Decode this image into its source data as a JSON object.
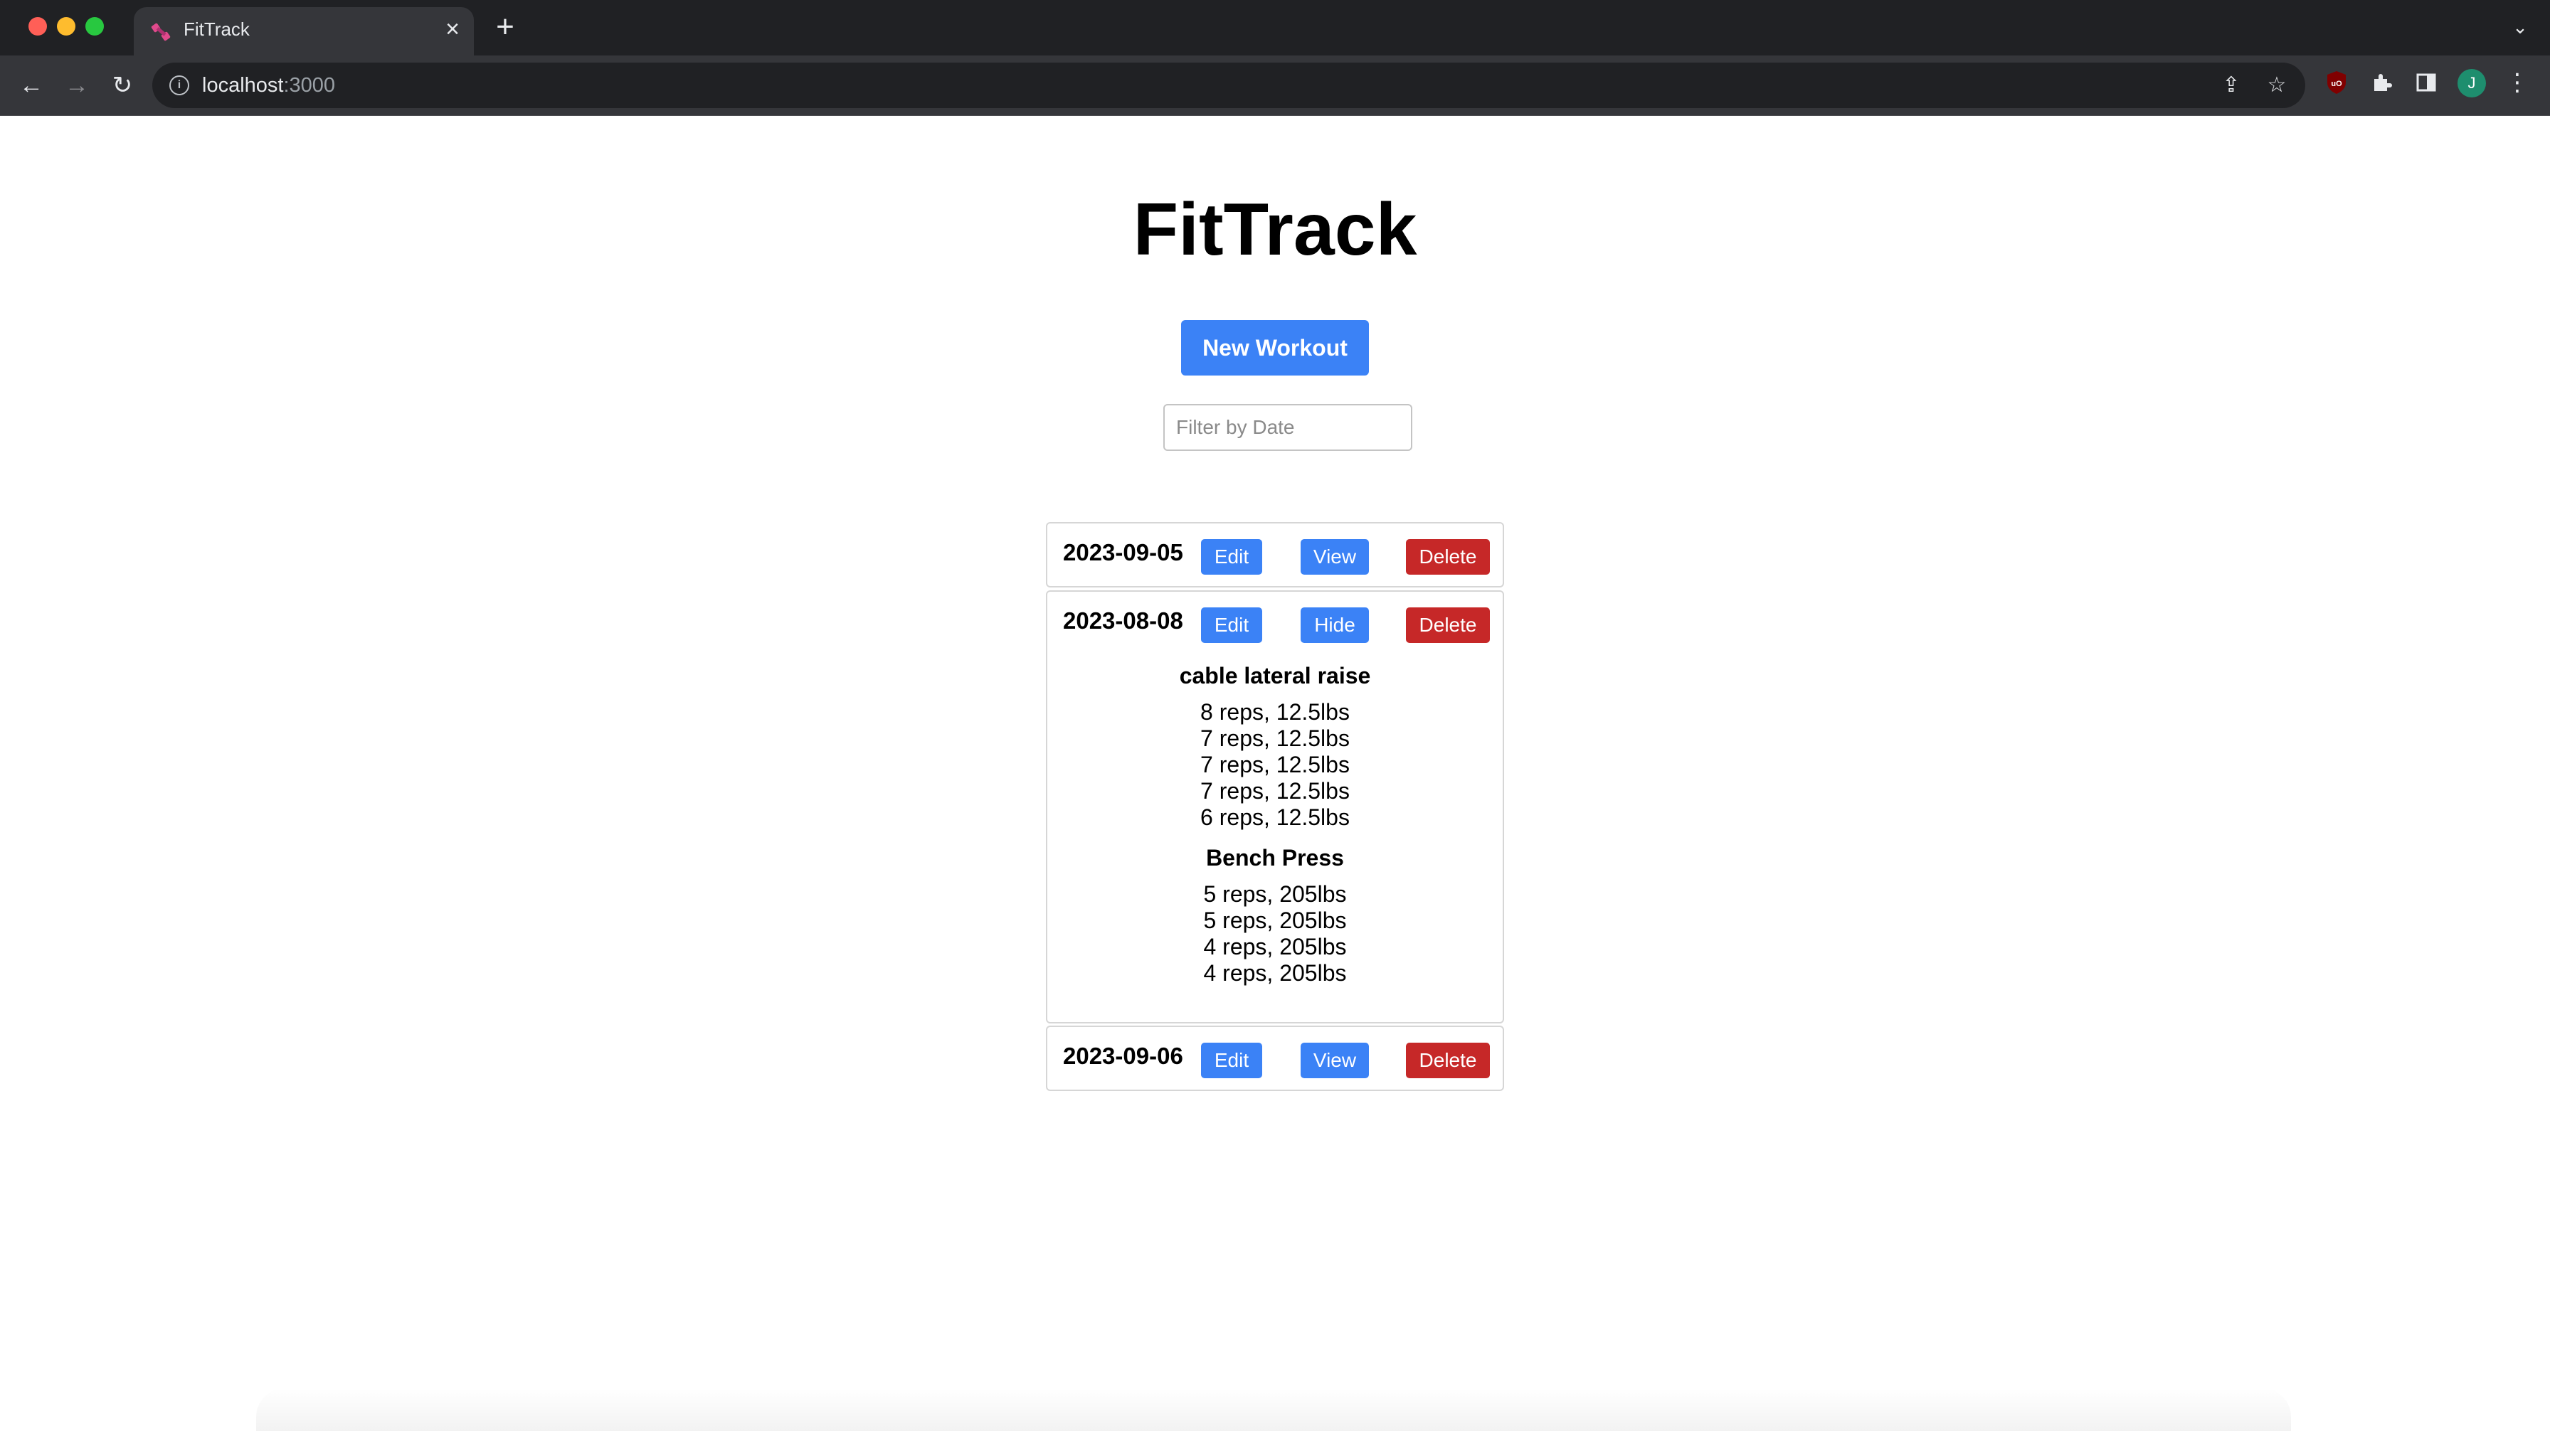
{
  "browser": {
    "tab_title": "FitTrack",
    "url_host": "localhost",
    "url_port": ":3000",
    "avatar_letter": "J"
  },
  "app": {
    "title": "FitTrack",
    "new_workout_label": "New Workout",
    "filter_placeholder": "Filter by Date",
    "filter_value": ""
  },
  "workouts": [
    {
      "date": "2023-09-05",
      "edit_label": "Edit",
      "toggle_label": "View",
      "delete_label": "Delete",
      "expanded": false
    },
    {
      "date": "2023-08-08",
      "edit_label": "Edit",
      "toggle_label": "Hide",
      "delete_label": "Delete",
      "expanded": true,
      "exercises": [
        {
          "name": "cable lateral raise",
          "sets": [
            "8 reps, 12.5lbs",
            "7 reps, 12.5lbs",
            "7 reps, 12.5lbs",
            "7 reps, 12.5lbs",
            "6 reps, 12.5lbs"
          ]
        },
        {
          "name": "Bench Press",
          "sets": [
            "5 reps, 205lbs",
            "5 reps, 205lbs",
            "4 reps, 205lbs",
            "4 reps, 205lbs"
          ]
        }
      ]
    },
    {
      "date": "2023-09-06",
      "edit_label": "Edit",
      "toggle_label": "View",
      "delete_label": "Delete",
      "expanded": false
    }
  ],
  "colors": {
    "primary": "#3b82f6",
    "danger": "#c62828"
  }
}
